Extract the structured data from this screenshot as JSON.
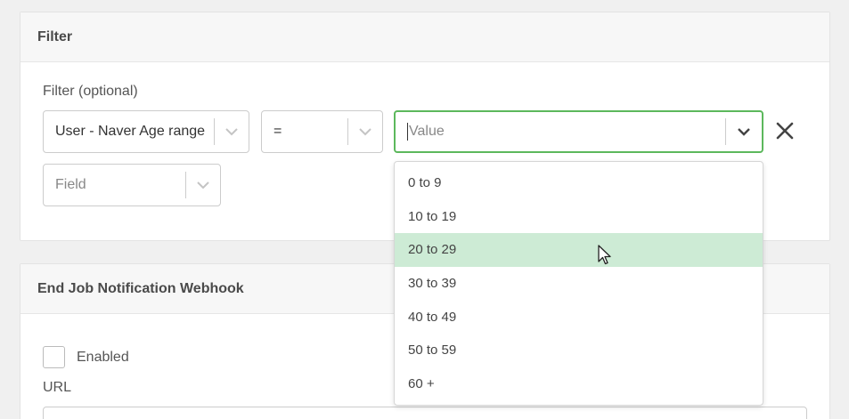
{
  "filter_panel": {
    "title": "Filter",
    "filter_label": "Filter (optional)",
    "field_select": {
      "value": "User - Naver Age range"
    },
    "operator_select": {
      "value": "="
    },
    "value_select": {
      "placeholder": "Value"
    },
    "extra_field_select": {
      "placeholder": "Field"
    },
    "options": [
      "0 to 9",
      "10 to 19",
      "20 to 29",
      "30 to 39",
      "40 to 49",
      "50 to 59",
      "60 +"
    ],
    "highlighted_option": "20 to 29"
  },
  "webhook_panel": {
    "title": "End Job Notification Webhook",
    "enabled_label": "Enabled",
    "url_label": "URL"
  },
  "icons": {
    "chevron": "chevron-down-icon",
    "clear": "close-icon",
    "pointer": "mouse-pointer-icon"
  },
  "colors": {
    "focus_border": "#5cb85c",
    "highlight_bg": "#cdebd5"
  }
}
